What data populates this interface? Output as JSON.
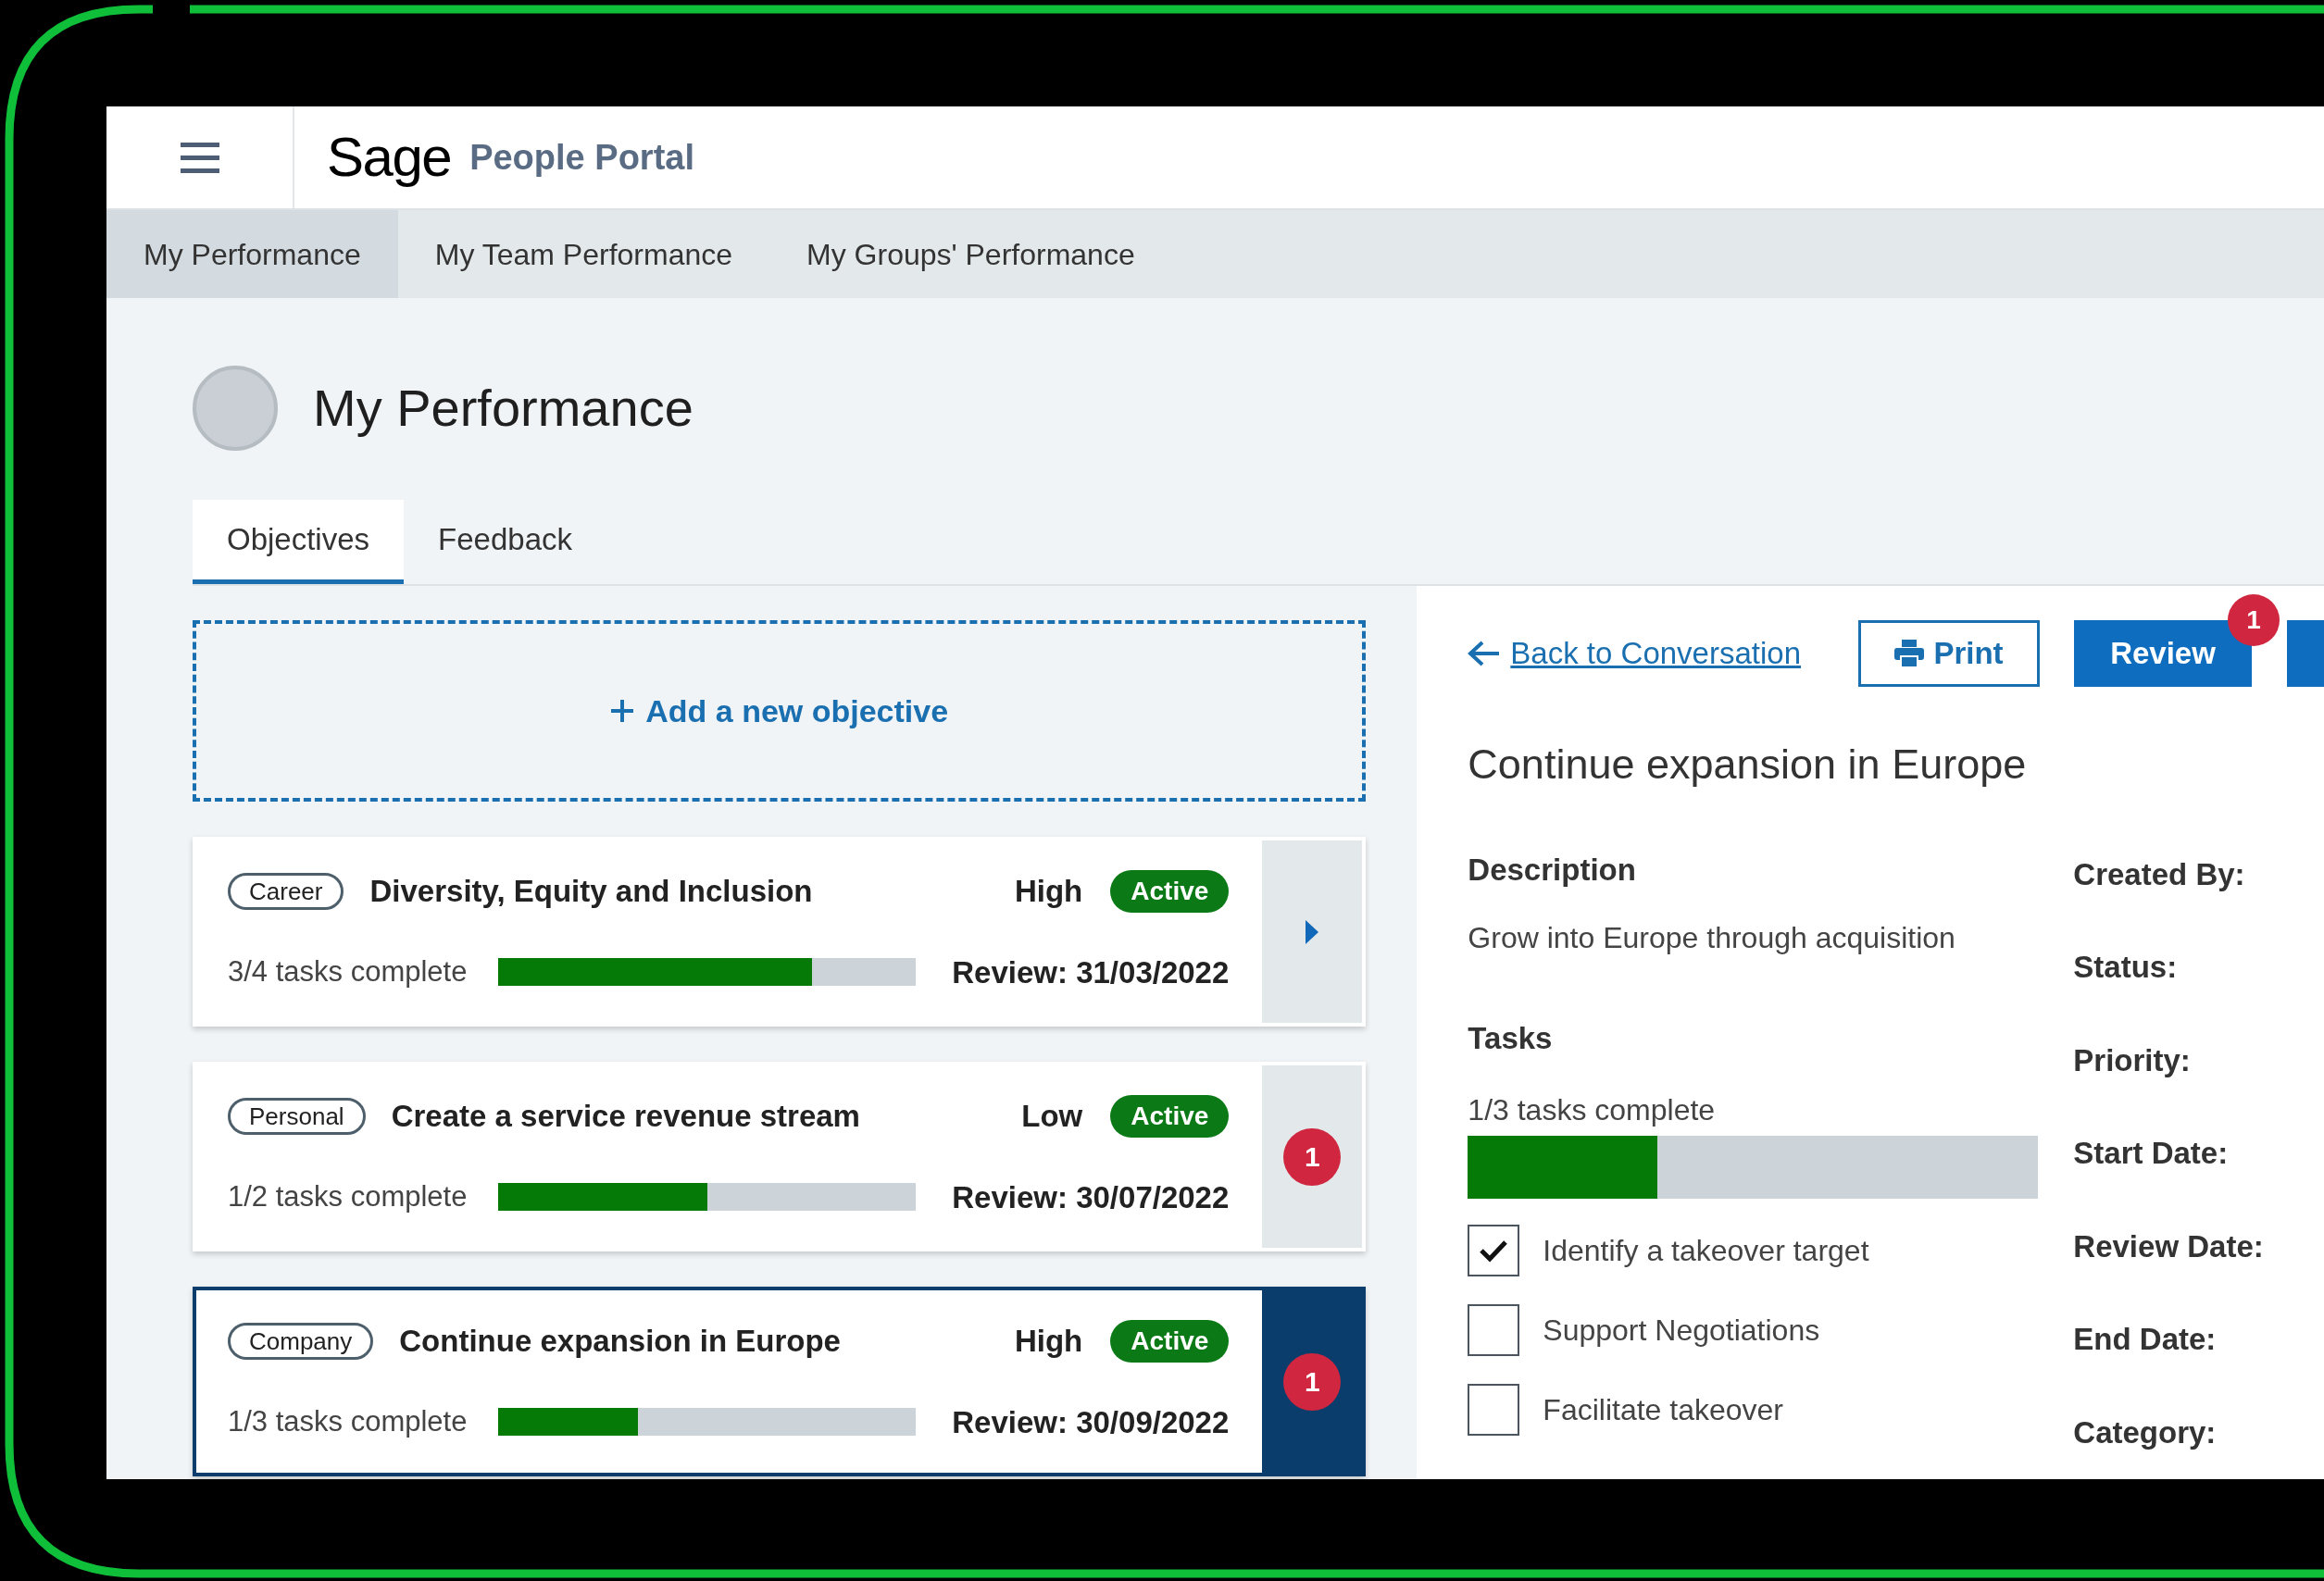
{
  "header": {
    "logo": "Sage",
    "title": "People Portal"
  },
  "nav": [
    {
      "label": "My Performance",
      "selected": true
    },
    {
      "label": "My Team Performance",
      "selected": false
    },
    {
      "label": "My Groups' Performance",
      "selected": false
    }
  ],
  "page": {
    "title": "My Performance"
  },
  "tabs": [
    {
      "label": "Objectives",
      "selected": true
    },
    {
      "label": "Feedback",
      "selected": false
    }
  ],
  "add_objective": {
    "label": "Add a new objective"
  },
  "objectives": [
    {
      "category": "Career",
      "title": "Diversity, Equity and Inclusion",
      "priority": "High",
      "status": "Active",
      "progress_text": "3/4 tasks complete",
      "level": 0.75,
      "review": "Review: 31/03/2022",
      "selected": false,
      "kind": "arrow"
    },
    {
      "category": "Personal",
      "title": "Create a service revenue stream",
      "priority": "Low",
      "status": "Active",
      "progress_text": "1/2 tasks complete",
      "level": 0.5,
      "review": "Review: 30/07/2022",
      "selected": false,
      "kind": "badge",
      "badge": "1"
    },
    {
      "category": "Company",
      "title": "Continue expansion in Europe",
      "priority": "High",
      "status": "Active",
      "progress_text": "1/3 tasks complete",
      "level": 0.333,
      "review": "Review: 30/09/2022",
      "selected": true,
      "kind": "badge",
      "badge": "1"
    }
  ],
  "detail": {
    "back_link": "Back to Conversation",
    "print": "Print",
    "review": {
      "label": "Review",
      "badge": "1"
    },
    "title": "Continue expansion in Europe",
    "description_label": "Description",
    "description": "Grow into Europe through acquisition",
    "tasks_label": "Tasks",
    "progress_text": "1/3 tasks complete",
    "level": 0.333,
    "tasks": [
      {
        "label": "Identify a takeover target",
        "checked": true
      },
      {
        "label": "Support Negotiations",
        "checked": false
      },
      {
        "label": "Facilitate takeover",
        "checked": false
      }
    ],
    "fields": [
      "Created By:",
      "Status:",
      "Priority:",
      "Start Date:",
      "Review Date:",
      "End Date:",
      "Category:"
    ]
  }
}
